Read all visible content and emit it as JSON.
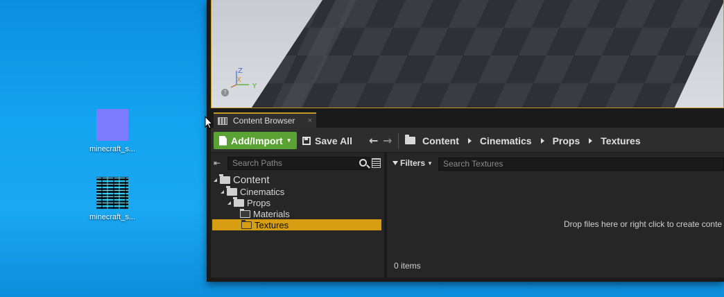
{
  "desktop": {
    "icons": [
      {
        "label": "minecraft_s...",
        "icon": "purple-image-icon",
        "color": "#7c7cff"
      },
      {
        "label": "minecraft_s...",
        "icon": "glitch-image-icon"
      }
    ]
  },
  "editor": {
    "tab": {
      "label": "Content Browser",
      "close": "×"
    },
    "toolbar": {
      "add_import": "Add/Import",
      "save_all": "Save All",
      "back": "🡐",
      "forward": "🡒"
    },
    "breadcrumb": [
      "Content",
      "Cinematics",
      "Props",
      "Textures"
    ],
    "sources": {
      "search_placeholder": "Search Paths",
      "tree": [
        {
          "label": "Content",
          "level": 0
        },
        {
          "label": "Cinematics",
          "level": 1
        },
        {
          "label": "Props",
          "level": 2
        },
        {
          "label": "Materials",
          "level": 3
        },
        {
          "label": "Textures",
          "level": 3,
          "selected": true
        }
      ]
    },
    "assets": {
      "filters_label": "Filters",
      "search_placeholder": "Search Textures",
      "drop_hint": "Drop files here or right click to create conte",
      "item_count": "0 items"
    },
    "viewport": {
      "axis_z": "Z",
      "axis_x": "X",
      "axis_y": "Y",
      "help": "?"
    }
  },
  "colors": {
    "accent": "#d89e12",
    "add_button": "#5aa233",
    "desktop": "#14a3f0"
  }
}
